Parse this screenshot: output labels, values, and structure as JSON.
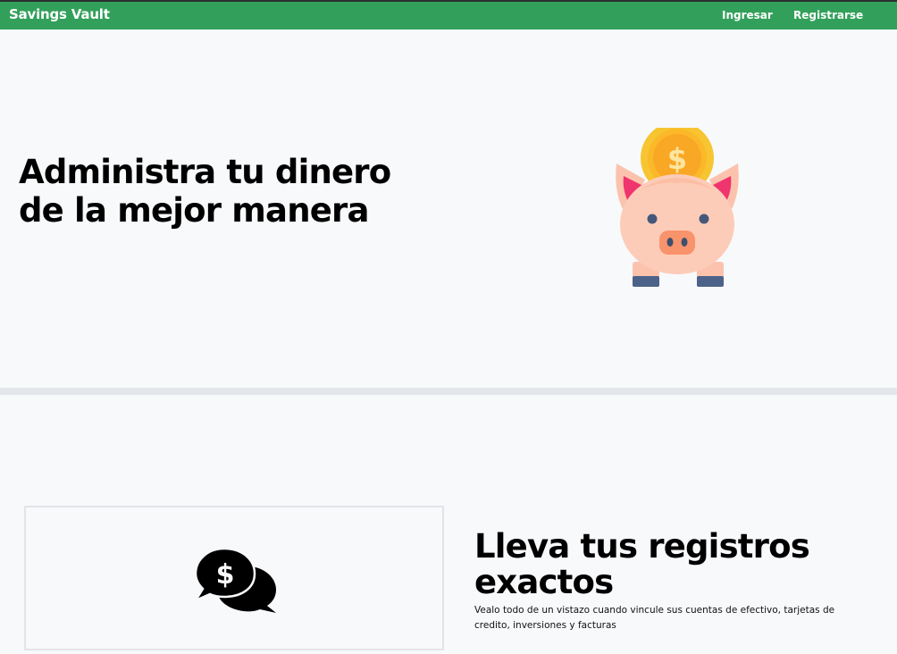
{
  "navbar": {
    "brand": "Savings Vault",
    "links": {
      "login": "Ingresar",
      "register": "Registrarse"
    },
    "background": "#32a05a"
  },
  "hero": {
    "title": "Administra tu dinero de la mejor manera",
    "illustration": "piggy-bank-icon"
  },
  "feature": {
    "icon": "chat-money-icon",
    "title": "Lleva tus registros exactos",
    "description": "Vealo todo de un vistazo cuando vincule sus cuentas de efectivo, tarjetas de credito, inversiones y facturas"
  }
}
